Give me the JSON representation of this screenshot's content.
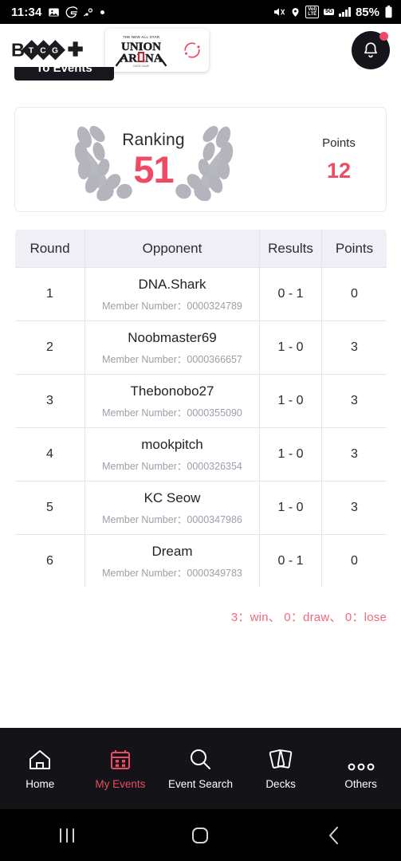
{
  "status_bar": {
    "time": "11:34",
    "left_icons": [
      "gallery-icon",
      "google-icon",
      "steam-icon",
      "dot-icon"
    ],
    "right_icons": [
      "mute-icon",
      "location-icon",
      "volte-icon",
      "5g-icon",
      "signal-icon",
      "battery-icon"
    ],
    "volte_top": "VoI)",
    "volte_bottom": "LTE",
    "network": "5G",
    "battery": "85%"
  },
  "header": {
    "brand_name": "BTCG+",
    "game_title": "UNION ARENA",
    "game_subtitle": "THE NEW ALL STAR",
    "reload_icon": "reload-icon",
    "bell_icon": "bell-icon",
    "has_notification": true
  },
  "to_events_button": {
    "label": "To Events"
  },
  "ranking_card": {
    "ranking_label": "Ranking",
    "ranking_value": "51",
    "points_label": "Points",
    "points_value": "12",
    "accent_color": "#ef4a63",
    "wreath_icon": "laurel-wreath-icon"
  },
  "results_table": {
    "headers": {
      "round": "Round",
      "opponent": "Opponent",
      "results": "Results",
      "points": "Points"
    },
    "member_prefix": "Member Number：",
    "rows": [
      {
        "round": "1",
        "name": "DNA.Shark",
        "member": "Member Number：0000324789",
        "result": "0 - 1",
        "points": "0"
      },
      {
        "round": "2",
        "name": "Noobmaster69",
        "member": "Member Number：0000366657",
        "result": "1 - 0",
        "points": "3"
      },
      {
        "round": "3",
        "name": "Thebonobo27",
        "member": "Member Number：0000355090",
        "result": "1 - 0",
        "points": "3"
      },
      {
        "round": "4",
        "name": "mookpitch",
        "member": "Member Number：0000326354",
        "result": "1 - 0",
        "points": "3"
      },
      {
        "round": "5",
        "name": "KC Seow",
        "member": "Member Number：0000347986",
        "result": "1 - 0",
        "points": "3"
      },
      {
        "round": "6",
        "name": "Dream",
        "member": "Member Number：0000349783",
        "result": "0 - 1",
        "points": "0"
      }
    ]
  },
  "summary": {
    "text": "3：win、 0：draw、 0：lose",
    "color": "#f0697c"
  },
  "bottom_nav": {
    "active_color": "#ef4a63",
    "items": [
      {
        "label": "Home",
        "icon": "home-icon",
        "active": false
      },
      {
        "label": "My Events",
        "icon": "calendar-icon",
        "active": true
      },
      {
        "label": "Event Search",
        "icon": "search-icon",
        "active": false
      },
      {
        "label": "Decks",
        "icon": "cards-icon",
        "active": false
      },
      {
        "label": "Others",
        "icon": "more-dots-icon",
        "active": false
      }
    ]
  },
  "android_nav": {
    "recents": "recents-icon",
    "home": "home-circle-icon",
    "back": "back-chevron-icon"
  }
}
